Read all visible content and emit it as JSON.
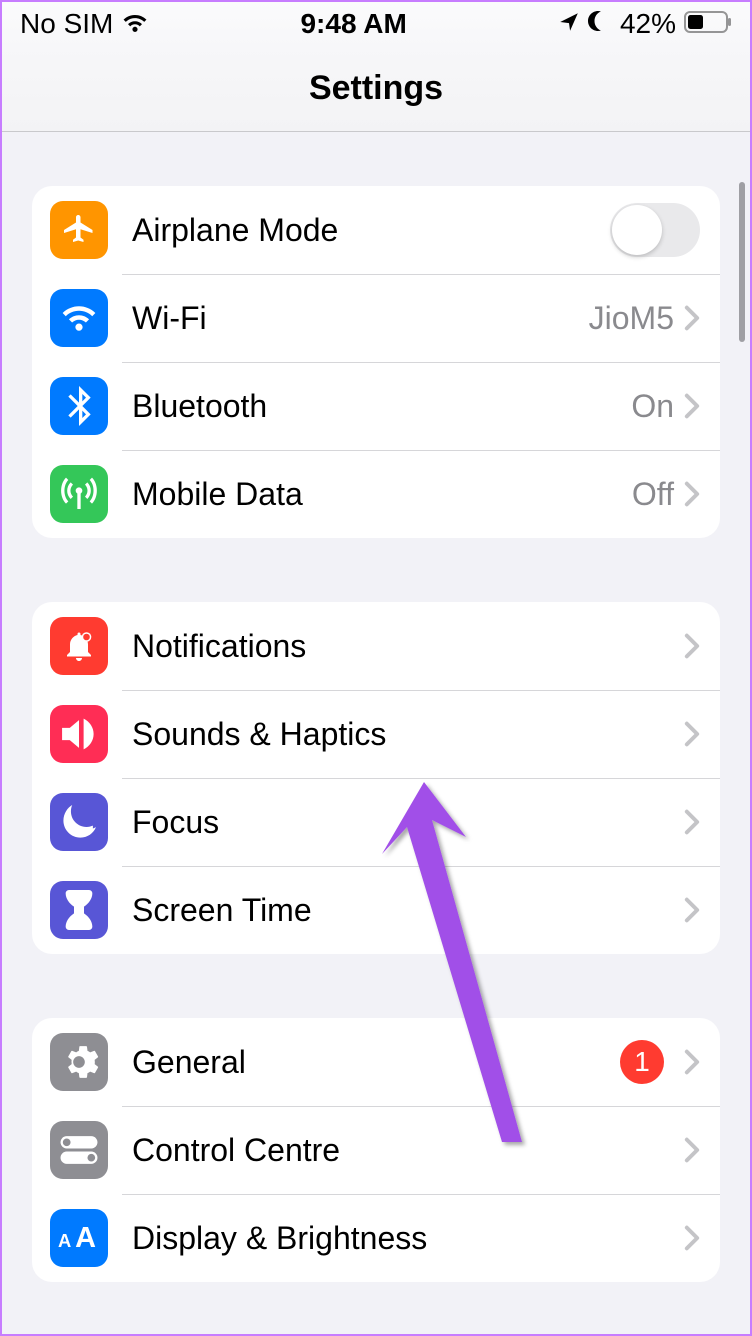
{
  "status": {
    "carrier": "No SIM",
    "time": "9:48 AM",
    "battery_pct": "42%"
  },
  "header": {
    "title": "Settings"
  },
  "groups": [
    {
      "partial": true,
      "rows": []
    },
    {
      "rows": [
        {
          "id": "airplane",
          "label": "Airplane Mode",
          "control": "toggle",
          "toggle_on": false
        },
        {
          "id": "wifi",
          "label": "Wi-Fi",
          "value": "JioM5",
          "control": "disclosure"
        },
        {
          "id": "bluetooth",
          "label": "Bluetooth",
          "value": "On",
          "control": "disclosure"
        },
        {
          "id": "mobiledata",
          "label": "Mobile Data",
          "value": "Off",
          "control": "disclosure"
        }
      ]
    },
    {
      "rows": [
        {
          "id": "notifications",
          "label": "Notifications",
          "control": "disclosure"
        },
        {
          "id": "sounds",
          "label": "Sounds & Haptics",
          "control": "disclosure"
        },
        {
          "id": "focus",
          "label": "Focus",
          "control": "disclosure"
        },
        {
          "id": "screentime",
          "label": "Screen Time",
          "control": "disclosure"
        }
      ]
    },
    {
      "rows": [
        {
          "id": "general",
          "label": "General",
          "badge": "1",
          "control": "disclosure"
        },
        {
          "id": "controlcentre",
          "label": "Control Centre",
          "control": "disclosure"
        },
        {
          "id": "display",
          "label": "Display & Brightness",
          "control": "disclosure"
        }
      ]
    }
  ]
}
